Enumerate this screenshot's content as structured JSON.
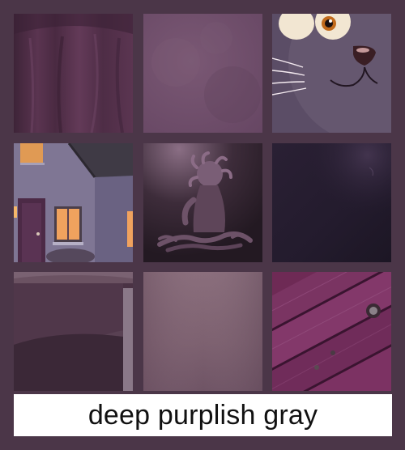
{
  "caption": {
    "text": "deep purplish gray"
  },
  "colors": {
    "frame": "#4b3648",
    "caption_background": "#ffffff",
    "caption_text": "#111111"
  },
  "tiles": [
    {
      "subject": "draped fabric"
    },
    {
      "subject": "textured surface"
    },
    {
      "subject": "cartoon cat face"
    },
    {
      "subject": "house with lit windows"
    },
    {
      "subject": "tentacle creature sculpture"
    },
    {
      "subject": "dark gradient"
    },
    {
      "subject": "ceramic bowl"
    },
    {
      "subject": "soft gradient"
    },
    {
      "subject": "weathered wood"
    }
  ]
}
